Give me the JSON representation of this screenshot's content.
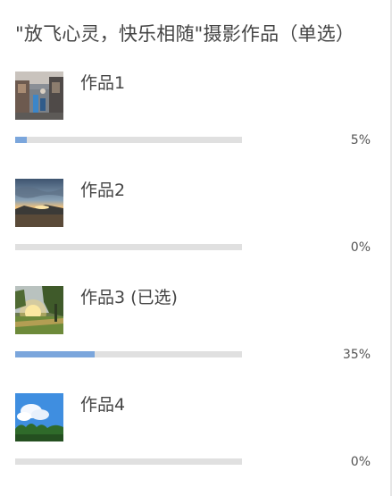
{
  "survey": {
    "title": "\"放飞心灵，快乐相随\"摄影作品（单选）"
  },
  "options": [
    {
      "label": "作品1",
      "percent_text": "5%",
      "percent": 5,
      "thumb_icon": "photo-street-thumbnail"
    },
    {
      "label": "作品2",
      "percent_text": "0%",
      "percent": 0,
      "thumb_icon": "photo-sunset-thumbnail"
    },
    {
      "label": "作品3 (已选)",
      "percent_text": "35%",
      "percent": 35,
      "selected": true,
      "thumb_icon": "photo-sunlight-trees-thumbnail"
    },
    {
      "label": "作品4",
      "percent_text": "0%",
      "percent": 0,
      "thumb_icon": "photo-sky-trees-thumbnail"
    }
  ],
  "colors": {
    "bar_fill": "#7ba6dc",
    "bar_track": "#e0e0e0",
    "text": "#444444"
  }
}
